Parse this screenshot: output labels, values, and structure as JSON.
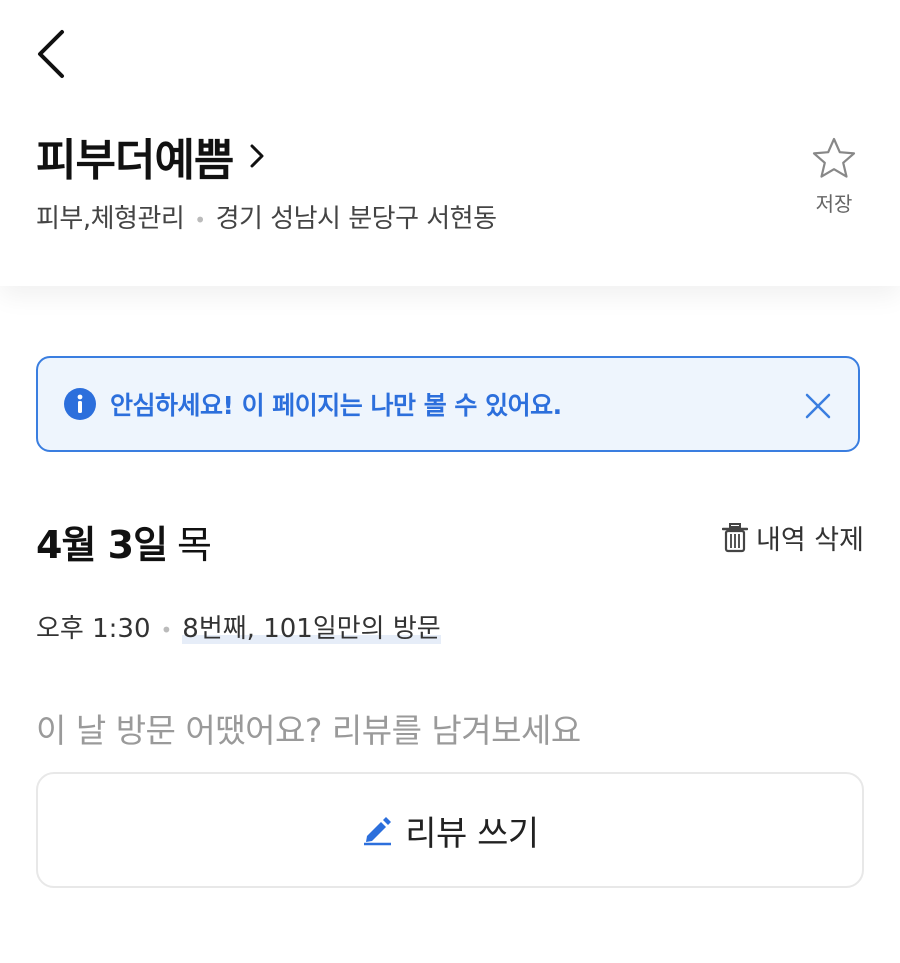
{
  "header": {
    "place_name": "피부더예쁨",
    "category": "피부,체형관리",
    "location": "경기 성남시 분당구 서현동",
    "save_label": "저장"
  },
  "notice": {
    "text": "안심하세요! 이 페이지는 나만 볼 수 있어요."
  },
  "visit": {
    "date_bold": "4월 3일",
    "day_of_week": "목",
    "delete_label": "내역 삭제",
    "time": "오후 1:30",
    "visit_count": "8번째, 101일만의 방문"
  },
  "review": {
    "prompt": "이 날 방문 어땠어요? 리뷰를 남겨보세요",
    "button_label": "리뷰 쓰기"
  },
  "colors": {
    "accent": "#2c6fdc",
    "notice_bg": "#eef5fd",
    "notice_border": "#3a7ee0"
  },
  "icons": {
    "back": "chevron-left-icon",
    "title_chevron": "chevron-right-icon",
    "save": "star-outline-icon",
    "info": "info-circle-icon",
    "close": "close-icon",
    "delete": "trash-icon",
    "pencil": "pencil-icon"
  }
}
